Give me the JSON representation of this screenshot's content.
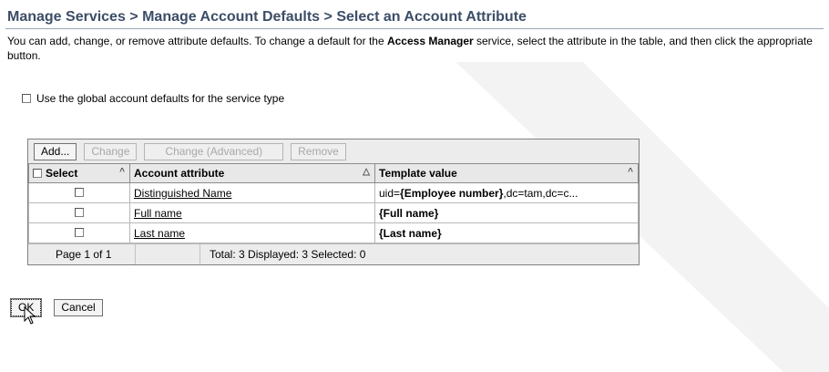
{
  "header": {
    "title": "Manage Services > Manage Account Defaults > Select an Account Attribute"
  },
  "description": {
    "part1": "You can add, change, or remove attribute defaults. To change a default for the ",
    "service": "Access Manager",
    "part2": " service, select the attribute in the table, and then click the appropriate button."
  },
  "global_defaults": {
    "label": "Use the global account defaults for the service type",
    "checked": false
  },
  "toolbar": {
    "add_label": "Add...",
    "change_label": "Change",
    "change_advanced_label": "Change (Advanced)",
    "remove_label": "Remove"
  },
  "table": {
    "columns": [
      "Select",
      "Account attribute",
      "Template value"
    ],
    "rows": [
      {
        "attribute": "Distinguished Name",
        "value_prefix": "uid=",
        "value_bold": "{Employee number}",
        "value_suffix": ",dc=tam,dc=c..."
      },
      {
        "attribute": "Full name",
        "value_prefix": "",
        "value_bold": "{Full name}",
        "value_suffix": ""
      },
      {
        "attribute": "Last name",
        "value_prefix": "",
        "value_bold": "{Last name}",
        "value_suffix": ""
      }
    ],
    "footer": {
      "page": "Page 1 of 1",
      "summary": "Total: 3  Displayed: 3  Selected: 0"
    }
  },
  "actions": {
    "ok_label": "OK",
    "cancel_label": "Cancel"
  },
  "colors": {
    "title": "#3c4d67",
    "watermark": "#f2f2f2"
  }
}
